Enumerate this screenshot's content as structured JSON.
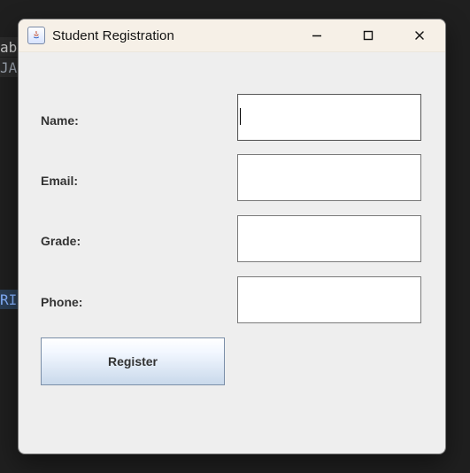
{
  "window": {
    "title": "Student Registration",
    "icon_name": "java-app-icon",
    "controls": {
      "minimize_icon": "minimize-icon",
      "maximize_icon": "maximize-icon",
      "close_icon": "close-icon"
    }
  },
  "form": {
    "fields": [
      {
        "key": "name",
        "label": "Name:",
        "value": "",
        "placeholder": ""
      },
      {
        "key": "email",
        "label": "Email:",
        "value": "",
        "placeholder": ""
      },
      {
        "key": "grade",
        "label": "Grade:",
        "value": "",
        "placeholder": ""
      },
      {
        "key": "phone",
        "label": "Phone:",
        "value": "",
        "placeholder": ""
      }
    ],
    "submit_label": "Register"
  },
  "background": {
    "fragments": [
      "ab",
      "JA",
      "RI"
    ]
  }
}
